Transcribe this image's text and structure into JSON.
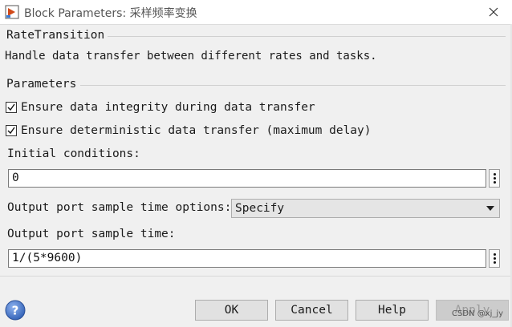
{
  "window": {
    "title": "Block Parameters: 采样频率变换"
  },
  "block": {
    "type_name": "RateTransition",
    "description": "Handle data transfer between different rates and tasks."
  },
  "parameters": {
    "group_title": "Parameters",
    "integrity_label": "Ensure data integrity during data transfer",
    "integrity_checked": true,
    "deterministic_label": "Ensure deterministic data transfer (maximum delay)",
    "deterministic_checked": true,
    "initial_conditions_label": "Initial conditions:",
    "initial_conditions_value": "0",
    "sample_time_options_label": "Output port sample time options:",
    "sample_time_options_value": "Specify",
    "sample_time_label": "Output port sample time:",
    "sample_time_value": "1/(5*9600)"
  },
  "buttons": {
    "ok": "OK",
    "cancel": "Cancel",
    "help": "Help",
    "apply": "Apply"
  },
  "watermark": "CSDN @xj_jy"
}
